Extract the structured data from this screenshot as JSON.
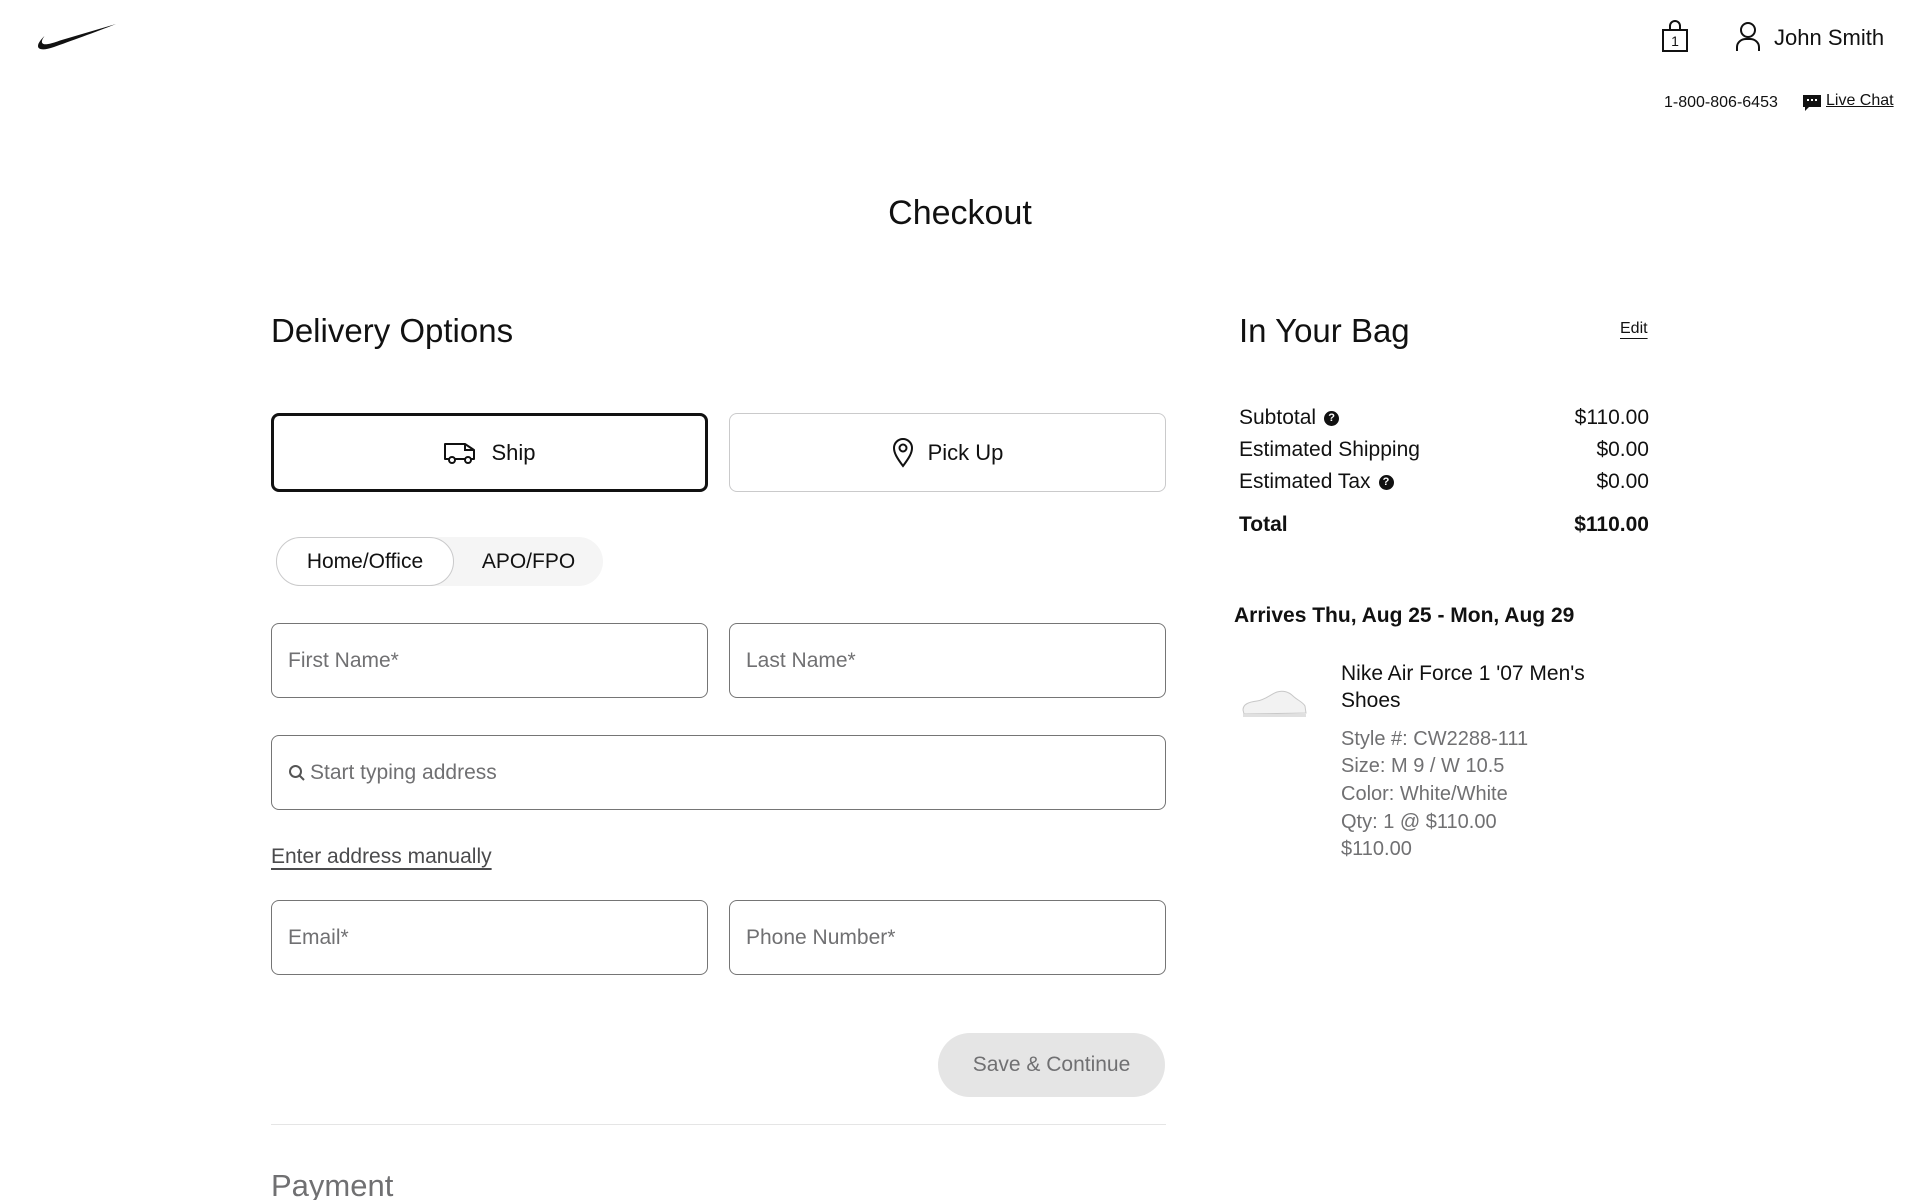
{
  "header": {
    "logo_icon": "nike-swoosh-icon",
    "bag_count": "1",
    "user_name": "John Smith",
    "phone": "1-800-806-6453",
    "live_chat": "Live Chat"
  },
  "page_title": "Checkout",
  "delivery": {
    "title": "Delivery Options",
    "options": [
      {
        "label": "Ship",
        "icon": "truck-icon",
        "selected": true
      },
      {
        "label": "Pick Up",
        "icon": "location-pin-icon",
        "selected": false
      }
    ],
    "address_types": [
      {
        "label": "Home/Office",
        "selected": true
      },
      {
        "label": "APO/FPO",
        "selected": false
      }
    ],
    "fields": {
      "first_name": "First Name*",
      "last_name": "Last Name*",
      "address": "Start typing address",
      "email": "Email*",
      "phone": "Phone Number*"
    },
    "manual_link": "Enter address manually",
    "save_button": "Save & Continue"
  },
  "payment": {
    "title": "Payment"
  },
  "bag": {
    "title": "In Your Bag",
    "edit": "Edit",
    "summary": {
      "subtotal_label": "Subtotal",
      "subtotal_value": "$110.00",
      "shipping_label": "Estimated Shipping",
      "shipping_value": "$0.00",
      "tax_label": "Estimated Tax",
      "tax_value": "$0.00",
      "total_label": "Total",
      "total_value": "$110.00"
    },
    "arrives": "Arrives Thu, Aug 25 - Mon, Aug 29",
    "item": {
      "name": "Nike Air Force 1 '07 Men's Shoes",
      "style": "Style #: CW2288-111",
      "size": "Size: M 9 / W 10.5",
      "color": "Color: White/White",
      "qty": "Qty: 1 @ $110.00",
      "price": "$110.00"
    }
  }
}
